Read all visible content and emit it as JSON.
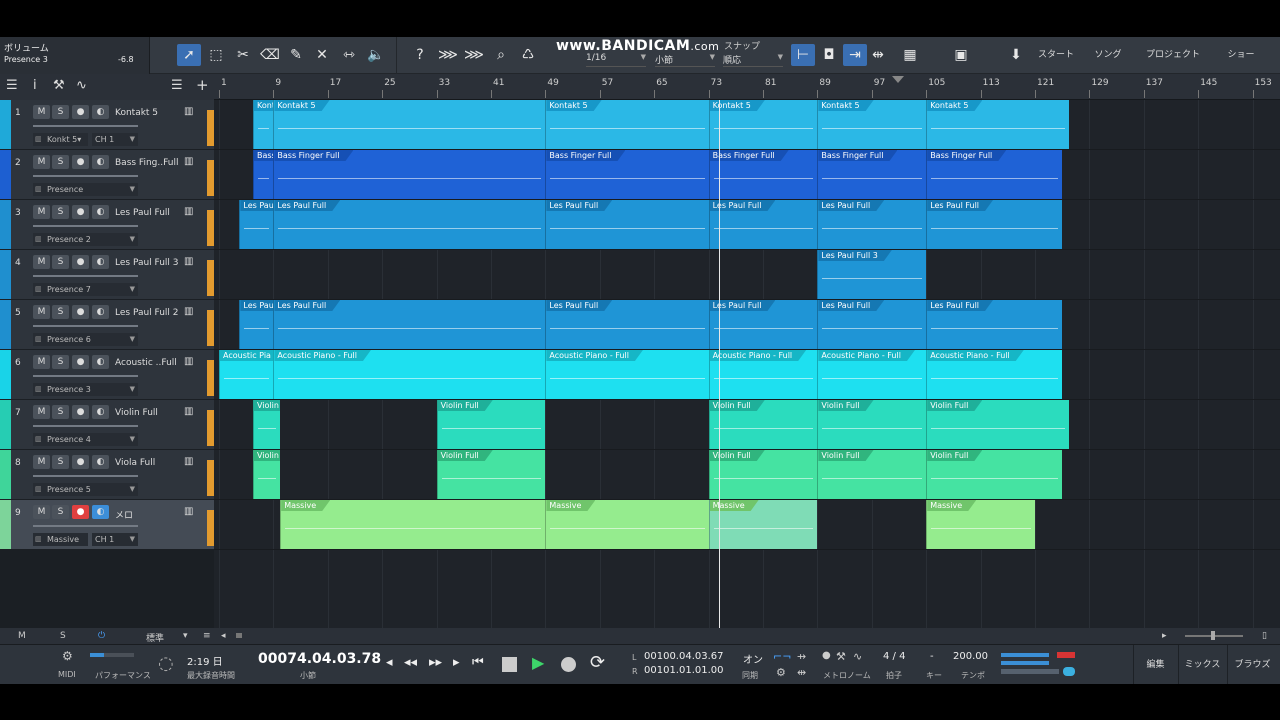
{
  "watermark": {
    "text": "www.BANDICAM",
    "suffix": ".com"
  },
  "toolbar": {
    "info_title": "ボリューム",
    "info_target": "Presence 3",
    "info_value": "-6.8",
    "snap_label": "スナップ",
    "quantize": "1/16",
    "timebase": "小節",
    "snap_mode": "順応",
    "right_buttons": [
      "スタート",
      "ソング",
      "プロジェクト",
      "ショー"
    ]
  },
  "ruler": {
    "bars": [
      "1",
      "9",
      "17",
      "25",
      "33",
      "41",
      "49",
      "57",
      "65",
      "73",
      "81",
      "89",
      "97",
      "105",
      "113",
      "121",
      "129",
      "137",
      "145",
      "153"
    ]
  },
  "tracks": [
    {
      "num": "1",
      "name": "Kontakt 5",
      "sel1": "Konkt 5▾",
      "sel2": "CH 1",
      "color": "#1fa9d9",
      "half": true
    },
    {
      "num": "2",
      "name": "Bass Fing..Full",
      "sel1": "Presence",
      "sel2": "",
      "color": "#1d5fd1",
      "half": false
    },
    {
      "num": "3",
      "name": "Les Paul Full",
      "sel1": "Presence 2",
      "sel2": "",
      "color": "#1f8fcf",
      "half": false
    },
    {
      "num": "4",
      "name": "Les Paul Full 3",
      "sel1": "Presence 7",
      "sel2": "",
      "color": "#1f8fcf",
      "half": false
    },
    {
      "num": "5",
      "name": "Les Paul Full 2",
      "sel1": "Presence 6",
      "sel2": "",
      "color": "#1f8fcf",
      "half": false
    },
    {
      "num": "6",
      "name": "Acoustic ..Full",
      "sel1": "Presence 3",
      "sel2": "",
      "color": "#19d3e8",
      "half": false
    },
    {
      "num": "7",
      "name": "Violin Full",
      "sel1": "Presence 4",
      "sel2": "",
      "color": "#26cdb3",
      "half": false
    },
    {
      "num": "8",
      "name": "Viola Full",
      "sel1": "Presence 5",
      "sel2": "",
      "color": "#3fd59a",
      "half": false
    },
    {
      "num": "9",
      "name": "メロ",
      "sel1": "Massive",
      "sel2": "CH 1",
      "color": "#7dd49a",
      "half": true
    }
  ],
  "track_buttons": {
    "mute": "M",
    "solo": "S"
  },
  "clips": {
    "kontakt": [
      "Konta",
      "Kontakt 5",
      "Kontakt 5",
      "Kontakt 5",
      "Kontakt 5",
      "Kontakt 5"
    ],
    "bass": [
      "Bass I",
      "Bass Finger Full",
      "Bass Finger Full",
      "Bass Finger Full",
      "Bass Finger Full",
      "Bass Finger Full"
    ],
    "lespaul": [
      "Les Paul",
      "Les Paul Full",
      "Les Paul Full",
      "Les Paul Full",
      "Les Paul Full",
      "Les Paul Full"
    ],
    "lespaul3": [
      "Les Paul Full 3"
    ],
    "lespaul2": [
      "Les Paul",
      "Les Paul Full",
      "Les Paul Full",
      "Les Paul Full",
      "Les Paul Full",
      "Les Paul Full"
    ],
    "acoustic": [
      "Acoustic Pia",
      "Acoustic Piano - Full",
      "Acoustic Piano - Full",
      "Acoustic Piano - Full",
      "Acoustic Piano - Full",
      "Acoustic Piano - Full"
    ],
    "violin": [
      "Violin",
      "Violin Full",
      "Violin Full",
      "Violin Full",
      "Violin Full"
    ],
    "viola": [
      "Violin",
      "Violin Full",
      "Violin Full",
      "Violin Full",
      "Violin Full"
    ],
    "massive": [
      "Massive",
      "Massive",
      "Massive",
      "Massive"
    ]
  },
  "bottom": {
    "m": "M",
    "s": "S",
    "zoom": "標準"
  },
  "transport": {
    "midi": "MIDI",
    "performance": "パフォーマンス",
    "rec_time": "2:19 日",
    "rec_time_label": "最大録音時間",
    "position": "00074.04.03.78",
    "position_label": "小節",
    "loop_l_label": "L",
    "loop_r_label": "R",
    "loop_l": "00100.04.03.67",
    "loop_r": "00101.01.01.00",
    "sync_on": "オン",
    "sync_label": "同期",
    "metronome_label": "メトロノーム",
    "time_sig": "4 / 4",
    "time_sig_label": "拍子",
    "key": "-",
    "key_label": "キー",
    "tempo": "200.00",
    "tempo_label": "テンポ",
    "right_buttons": [
      "編集",
      "ミックス",
      "ブラウズ"
    ]
  }
}
